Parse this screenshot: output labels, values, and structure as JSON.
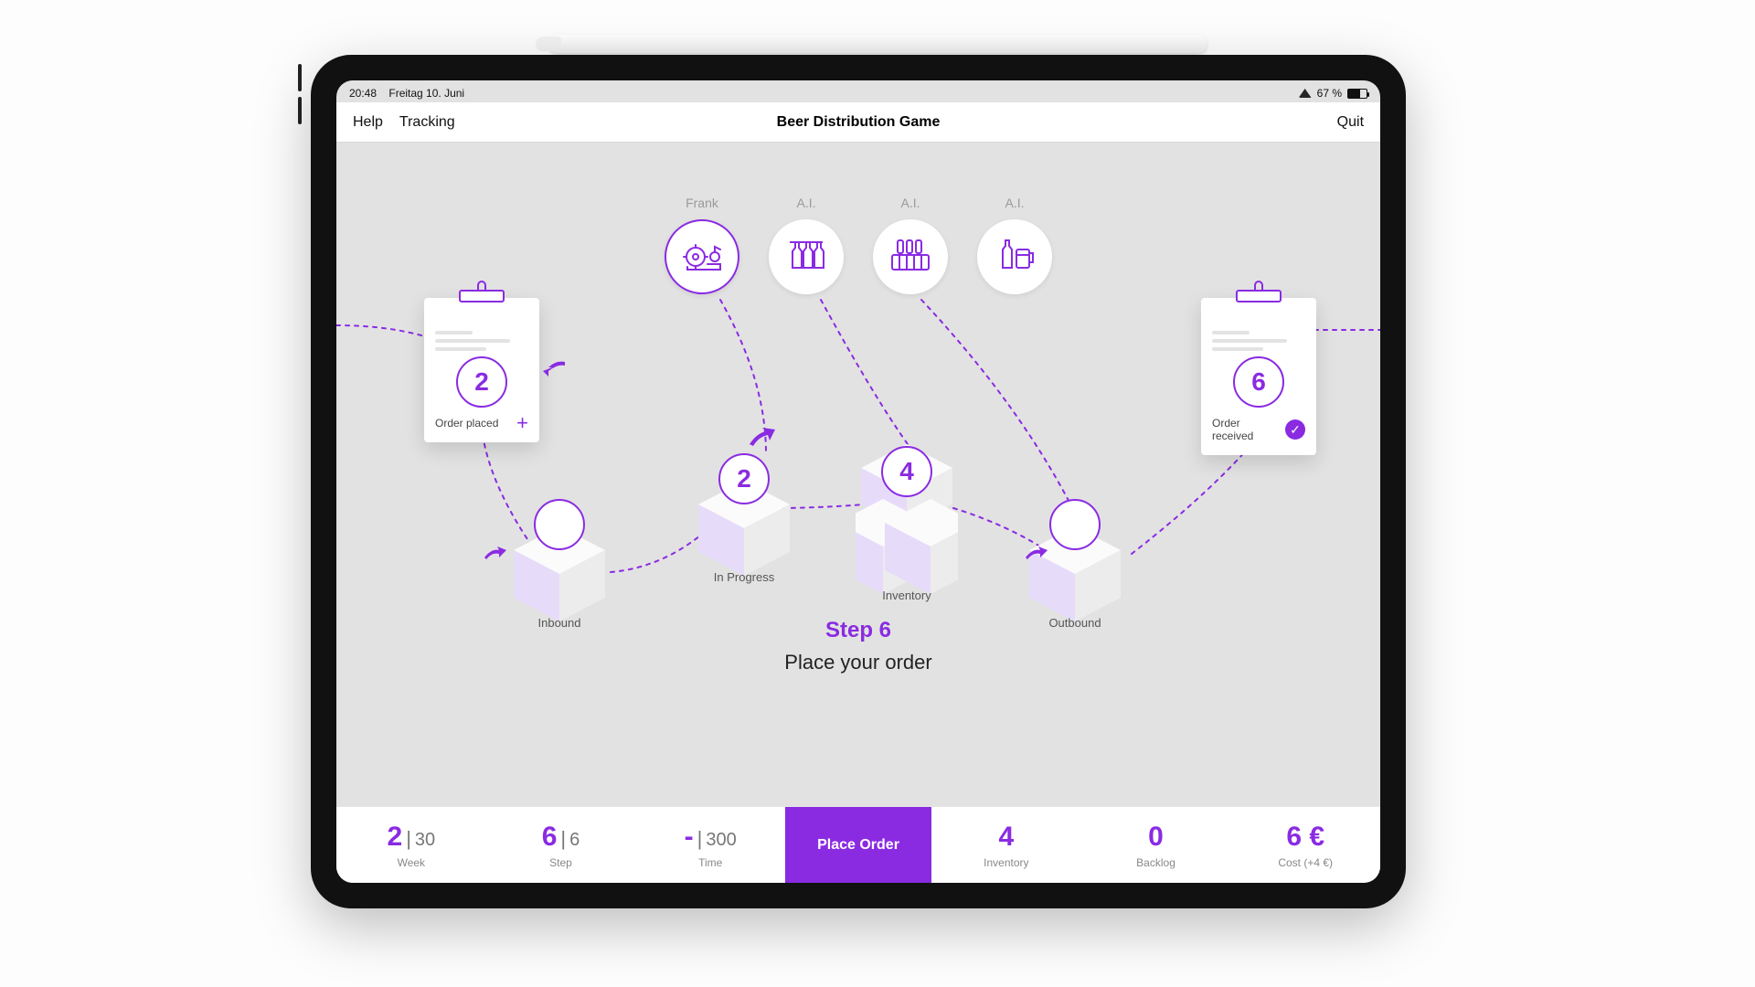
{
  "status": {
    "time": "20:48",
    "date": "Freitag 10. Juni",
    "battery_pct": "67 %"
  },
  "nav": {
    "help": "Help",
    "tracking": "Tracking",
    "title": "Beer Distribution Game",
    "quit": "Quit"
  },
  "roles": [
    {
      "label": "Frank",
      "icon": "factory",
      "selected": true
    },
    {
      "label": "A.I.",
      "icon": "bottles-hanging",
      "selected": false
    },
    {
      "label": "A.I.",
      "icon": "crate",
      "selected": false
    },
    {
      "label": "A.I.",
      "icon": "bottle-mug",
      "selected": false
    }
  ],
  "clip_left": {
    "value": "2",
    "label": "Order placed",
    "action_icon": "plus"
  },
  "clip_right": {
    "value": "6",
    "label": "Order\nreceived",
    "action_icon": "check"
  },
  "cubes": {
    "inbound": {
      "label": "Inbound",
      "value": ""
    },
    "inprogress": {
      "label": "In Progress",
      "value": "2"
    },
    "inventory": {
      "label": "Inventory",
      "value": "4"
    },
    "outbound": {
      "label": "Outbound",
      "value": ""
    }
  },
  "center": {
    "step_title": "Step 6",
    "prompt": "Place your order"
  },
  "bottom": {
    "week": {
      "value": "2",
      "max": "30",
      "label": "Week"
    },
    "step": {
      "value": "6",
      "max": "6",
      "label": "Step"
    },
    "time": {
      "value": "-",
      "max": "300",
      "label": "Time"
    },
    "place_btn": "Place Order",
    "inventory": {
      "value": "4",
      "label": "Inventory"
    },
    "backlog": {
      "value": "0",
      "label": "Backlog"
    },
    "cost": {
      "value": "6 €",
      "label": "Cost (+4 €)"
    }
  }
}
